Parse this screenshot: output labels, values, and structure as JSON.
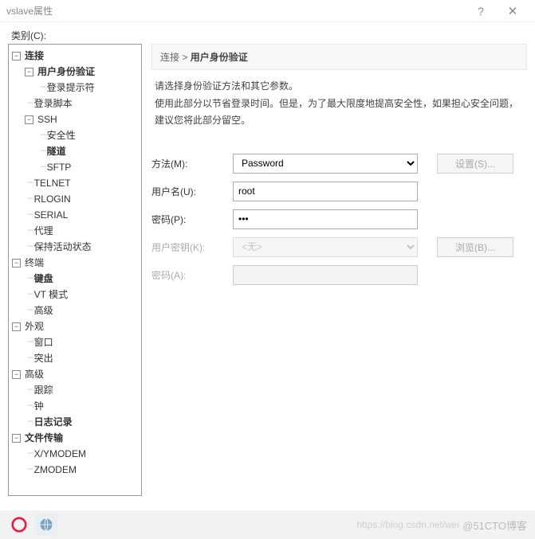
{
  "window": {
    "title": "vslave属性",
    "help": "?",
    "close": "✕"
  },
  "category_label": "类别(C):",
  "tree": {
    "connection": "连接",
    "auth": "用户身份验证",
    "login_prompt": "登录提示符",
    "login_script": "登录脚本",
    "ssh": "SSH",
    "security": "安全性",
    "tunnel": "隧道",
    "sftp": "SFTP",
    "telnet": "TELNET",
    "rlogin": "RLOGIN",
    "serial": "SERIAL",
    "proxy": "代理",
    "keepalive": "保持活动状态",
    "terminal": "终端",
    "keyboard": "键盘",
    "vtmode": "VT 模式",
    "advanced1": "高级",
    "appearance": "外观",
    "window": "窗口",
    "highlight": "突出",
    "advanced": "高级",
    "trace": "跟踪",
    "bell": "钟",
    "logging": "日志记录",
    "filetransfer": "文件传输",
    "xymodem": "X/YMODEM",
    "zmodem": "ZMODEM"
  },
  "breadcrumb": {
    "root": "连接",
    "sep": ">",
    "current": "用户身份验证"
  },
  "description": {
    "line1": "请选择身份验证方法和其它参数。",
    "line2": "使用此部分以节省登录时间。但是，为了最大限度地提高安全性，如果担心安全问题，建议您将此部分留空。"
  },
  "form": {
    "method_label": "方法(M):",
    "method_value": "Password",
    "settings_btn": "设置(S)...",
    "username_label": "用户名(U):",
    "username_value": "root",
    "password_label": "密码(P):",
    "password_value": "•••",
    "userkey_label": "用户密钥(K):",
    "userkey_value": "<无>",
    "browse_btn": "浏览(B)...",
    "passphrase_label": "密码(A):"
  },
  "watermark": {
    "url": "https://blog.csdn.net/wei",
    "brand": "@51CTO博客"
  }
}
